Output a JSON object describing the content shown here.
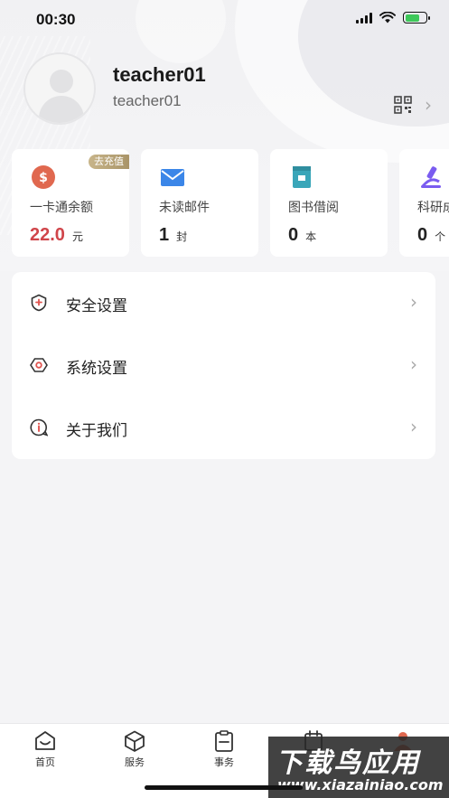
{
  "status_bar": {
    "time": "00:30"
  },
  "profile": {
    "name": "teacher01",
    "account": "teacher01"
  },
  "cards": [
    {
      "label": "一卡通余额",
      "value": "22.0",
      "unit": "元",
      "badge": "去充值",
      "icon": "dollar-coin-icon",
      "color": "#e0684f"
    },
    {
      "label": "未读邮件",
      "value": "1",
      "unit": "封",
      "icon": "mail-icon",
      "color": "#3b86e8"
    },
    {
      "label": "图书借阅",
      "value": "0",
      "unit": "本",
      "icon": "book-icon",
      "color": "#3aa6b9"
    },
    {
      "label": "科研成",
      "value": "0",
      "unit": "个",
      "icon": "microscope-icon",
      "color": "#7a5cf0"
    }
  ],
  "settings": [
    {
      "label": "安全设置",
      "icon": "shield-icon"
    },
    {
      "label": "系统设置",
      "icon": "gear-icon"
    },
    {
      "label": "关于我们",
      "icon": "info-chat-icon"
    }
  ],
  "tabbar": [
    {
      "label": "首页",
      "icon": "home-icon"
    },
    {
      "label": "服务",
      "icon": "cube-icon"
    },
    {
      "label": "事务",
      "icon": "clipboard-icon"
    },
    {
      "label": "",
      "icon": "calendar-icon"
    },
    {
      "label": "",
      "icon": "user-icon"
    }
  ],
  "watermark": {
    "line1": "下载鸟应用",
    "line2": "www.xiazainiao.com"
  }
}
